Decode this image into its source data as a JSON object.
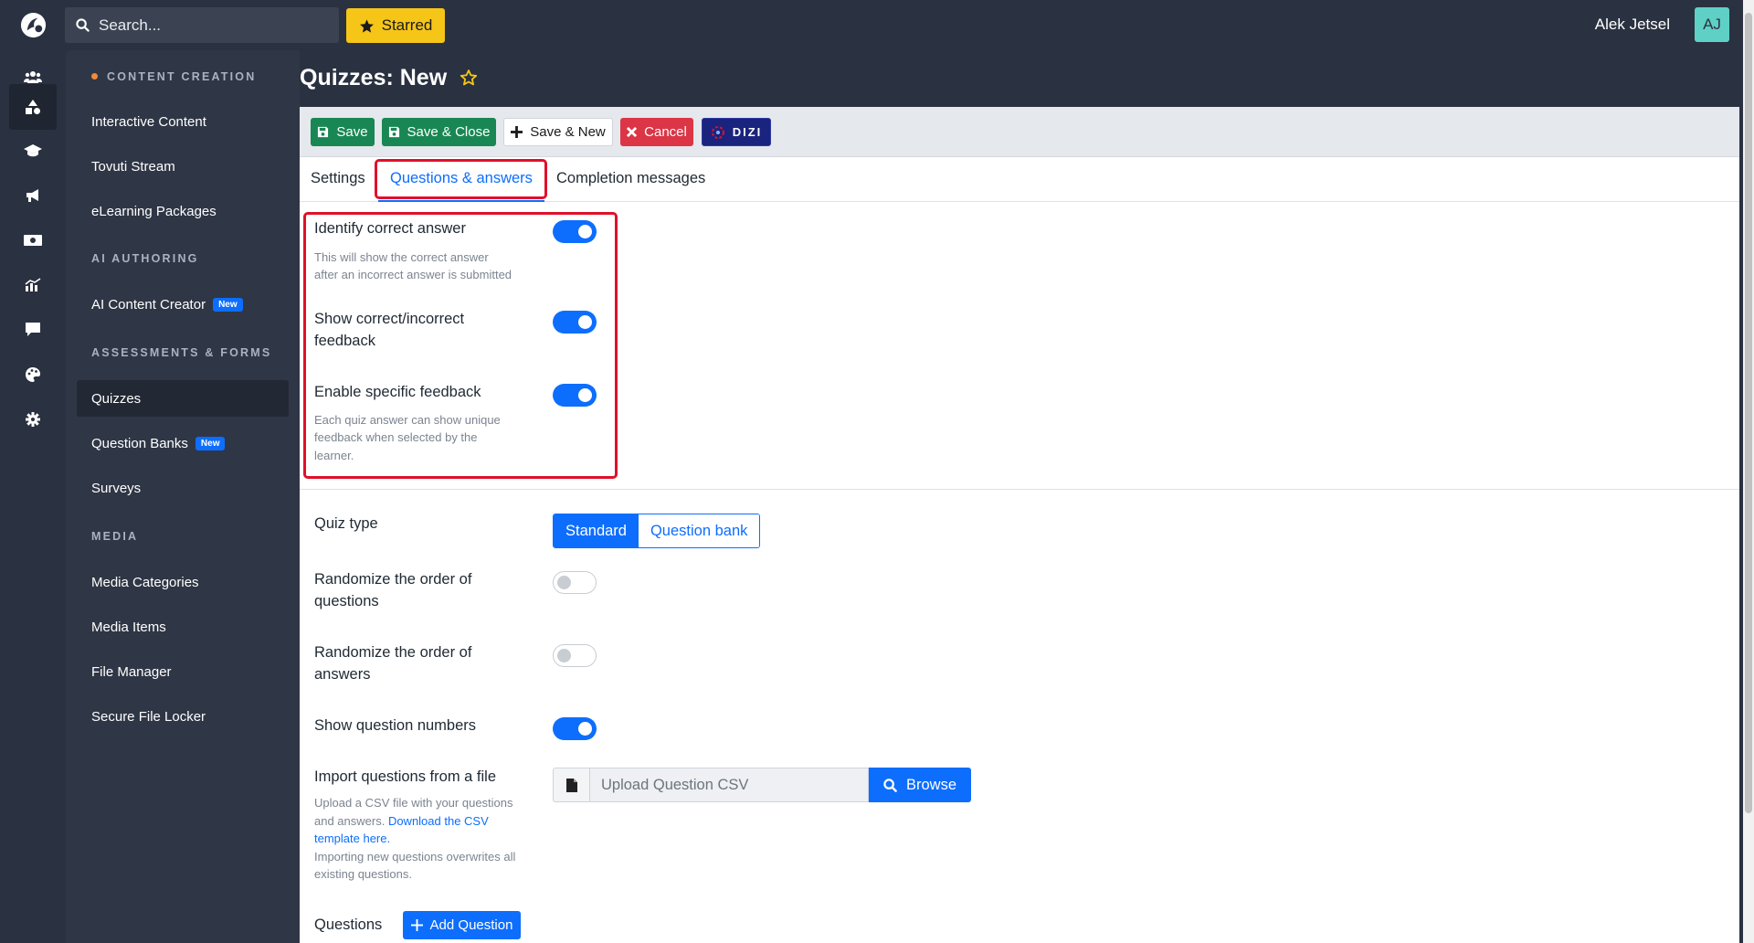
{
  "topbar": {
    "search_placeholder": "Search...",
    "starred_label": "Starred",
    "user_name": "Alek Jetsel",
    "user_initials": "AJ"
  },
  "rail": {
    "items": [
      "users-icon",
      "shapes-icon",
      "graduation-cap-icon",
      "megaphone-icon",
      "money-icon",
      "chart-icon",
      "chat-icon",
      "palette-icon",
      "gear-icon"
    ],
    "active_index": 1
  },
  "sidebar": {
    "sections": [
      {
        "header": "CONTENT CREATION",
        "items": [
          "Interactive Content",
          "Tovuti Stream",
          "eLearning Packages"
        ]
      },
      {
        "header": "AI AUTHORING",
        "items": [
          "AI Content Creator"
        ]
      },
      {
        "header": "ASSESSMENTS & FORMS",
        "items": [
          "Quizzes",
          "Question Banks",
          "Surveys"
        ]
      },
      {
        "header": "MEDIA",
        "items": [
          "Media Categories",
          "Media Items",
          "File Manager",
          "Secure File Locker"
        ]
      }
    ],
    "active_item": "Quizzes",
    "new_badge": "New"
  },
  "page": {
    "title": "Quizzes: New"
  },
  "toolbar": {
    "save": "Save",
    "save_close": "Save & Close",
    "save_new": "Save & New",
    "cancel": "Cancel",
    "dizi": "DIZI"
  },
  "tabs": {
    "settings": "Settings",
    "questions_answers": "Questions & answers",
    "completion_messages": "Completion messages",
    "active": "Questions & answers"
  },
  "form": {
    "identify_correct": {
      "label": "Identify correct answer",
      "help_1": "This will show the correct answer",
      "help_2": "after an incorrect answer is submitted",
      "enabled": true
    },
    "show_feedback": {
      "label_1": "Show correct/incorrect",
      "label_2": "feedback",
      "enabled": true
    },
    "specific_feedback": {
      "label": "Enable specific feedback",
      "help_1": "Each quiz answer can show unique",
      "help_2": "feedback when selected by the",
      "help_3": "learner.",
      "enabled": true
    },
    "quiz_type": {
      "label": "Quiz type",
      "options": [
        "Standard",
        "Question bank"
      ],
      "selected": "Standard"
    },
    "randomize_questions": {
      "label_1": "Randomize the order of",
      "label_2": "questions",
      "enabled": false
    },
    "randomize_answers": {
      "label_1": "Randomize the order of",
      "label_2": "answers",
      "enabled": false
    },
    "question_numbers": {
      "label": "Show question numbers",
      "enabled": true
    },
    "import": {
      "label": "Import questions from a file",
      "help_1": "Upload a CSV file with your questions",
      "help_2a": "and answers. ",
      "help_link_1": "Download the CSV",
      "help_link_2": "template here.",
      "help_3": "Importing new questions overwrites all",
      "help_4": "existing questions.",
      "placeholder": "Upload Question CSV",
      "browse": "Browse"
    },
    "questions": {
      "label": "Questions",
      "add_button": "Add Question"
    }
  },
  "colors": {
    "accent": "#0d6efd",
    "highlight": "#e0102a",
    "starred": "#f5c518",
    "avatar": "#5fd0c6",
    "green": "#198754",
    "red": "#dc3545"
  }
}
